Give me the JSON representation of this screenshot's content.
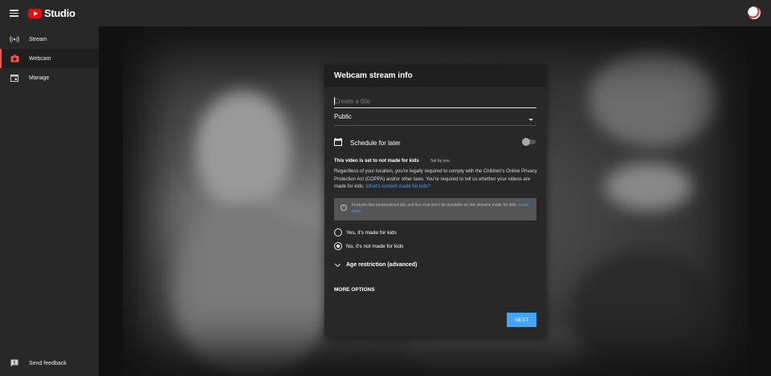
{
  "app": {
    "title": "Studio"
  },
  "sidebar": {
    "items": [
      {
        "label": "Stream",
        "icon": "broadcast-icon"
      },
      {
        "label": "Webcam",
        "icon": "webcam-icon",
        "active": true
      },
      {
        "label": "Manage",
        "icon": "calendar-icon"
      }
    ],
    "feedback": {
      "label": "Send feedback",
      "icon": "feedback-icon"
    }
  },
  "modal": {
    "title": "Webcam stream info",
    "title_placeholder": "Create a title",
    "privacy": "Public",
    "schedule_label": "Schedule for later",
    "kids_heading": "This video is set to not made for kids",
    "kids_set_by": "Set by you",
    "kids_body": "Regardless of your location, you're legally required to comply with the Children's Online Privacy Protection Act (COPPA) and/or other laws. You're required to tell us whether your videos are made for kids.",
    "kids_link": "What's content made for kids?",
    "notice_text": "Features like personalized ads and live chat won't be available on live streams made for kids.",
    "notice_link": "Learn more.",
    "radio_yes": "Yes, it's made for kids",
    "radio_no": "No, it's not made for kids",
    "selected": "no",
    "age_label": "Age restriction (advanced)",
    "more_options": "MORE OPTIONS",
    "next_label": "NEXT"
  },
  "colors": {
    "accent": "#3ea6ff",
    "brand": "#ff0000",
    "active_marker": "#ff4e45"
  }
}
